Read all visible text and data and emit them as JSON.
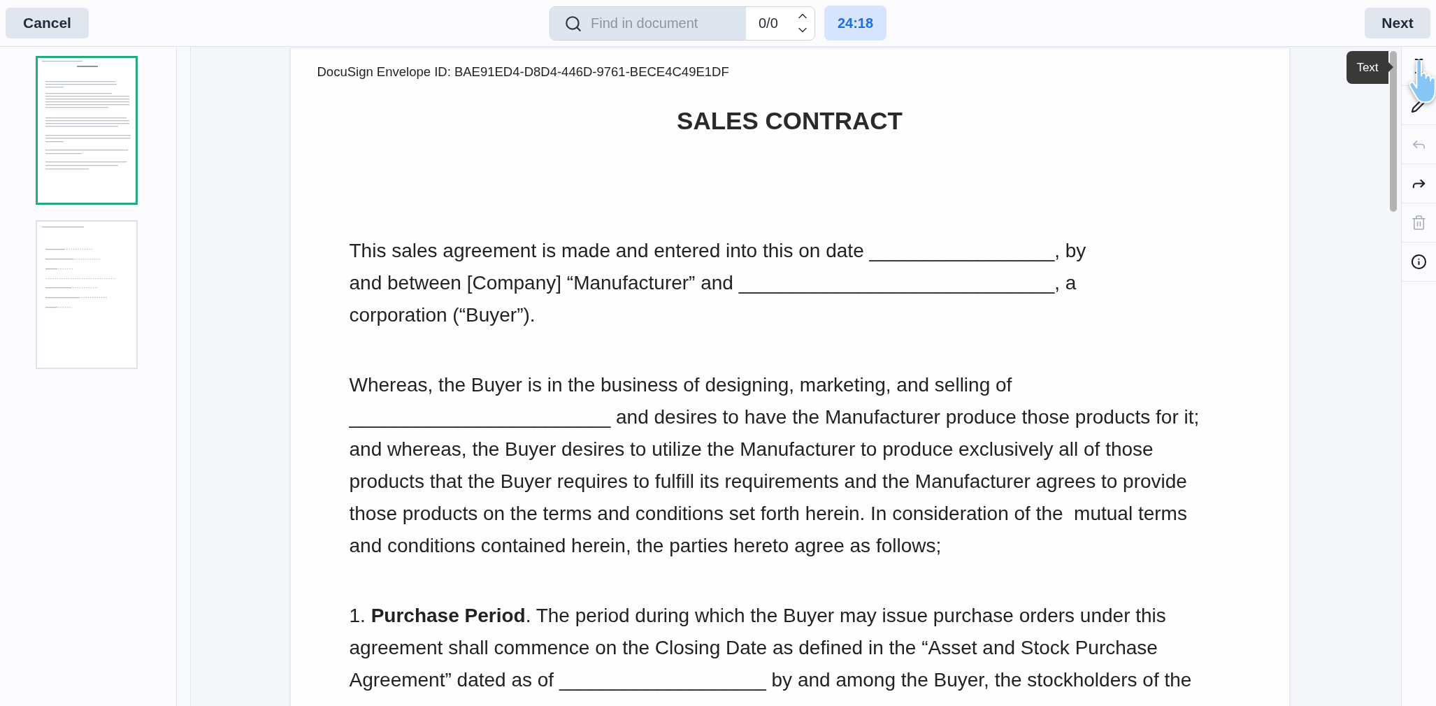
{
  "top_bar": {
    "cancel_button": "Cancel",
    "search": {
      "placeholder": "Find in document",
      "match_count": "0/0"
    },
    "timer": "24:18",
    "next_button": "Next"
  },
  "thumbnails": [
    {
      "selected": true
    },
    {
      "selected": false
    }
  ],
  "document": {
    "envelope_id": "DocuSign Envelope ID: BAE91ED4-D8D4-446D-9761-BECE4C49E1DF",
    "title": "SALES CONTRACT",
    "paragraphs": [
      {
        "lines": [
          "This sales agreement is made and entered into this on date _________________, by",
          "and between [Company] “Manufacturer” and _____________________________, a",
          "corporation (“Buyer”)."
        ]
      },
      {
        "lines": [
          "Whereas, the Buyer is in the business of designing, marketing, and selling of",
          "________________________ and desires to have the Manufacturer produce those products for it;",
          "and whereas, the Buyer desires to utilize the Manufacturer to produce exclusively all of those",
          "products that the Buyer requires to fulfill its requirements and the Manufacturer agrees to provide",
          "those products on the terms and conditions set forth herein. In consideration of the  mutual terms",
          "and conditions contained herein, the parties hereto agree as follows;"
        ]
      },
      {
        "lines": [
          "1. **Purchase Period**. The period during which the Buyer may issue purchase orders under this",
          "agreement shall commence on the Closing Date as defined in the “Asset and Stock Purchase",
          "Agreement” dated as of ___________________ by and among the Buyer, the stockholders of the"
        ]
      }
    ]
  },
  "tools": [
    {
      "kind": "text",
      "disabled": false,
      "tooltip": "Text"
    },
    {
      "kind": "signature",
      "disabled": false
    },
    {
      "kind": "undo",
      "disabled": true
    },
    {
      "kind": "redo",
      "disabled": false
    },
    {
      "kind": "delete",
      "disabled": true
    },
    {
      "kind": "info",
      "disabled": false
    }
  ]
}
